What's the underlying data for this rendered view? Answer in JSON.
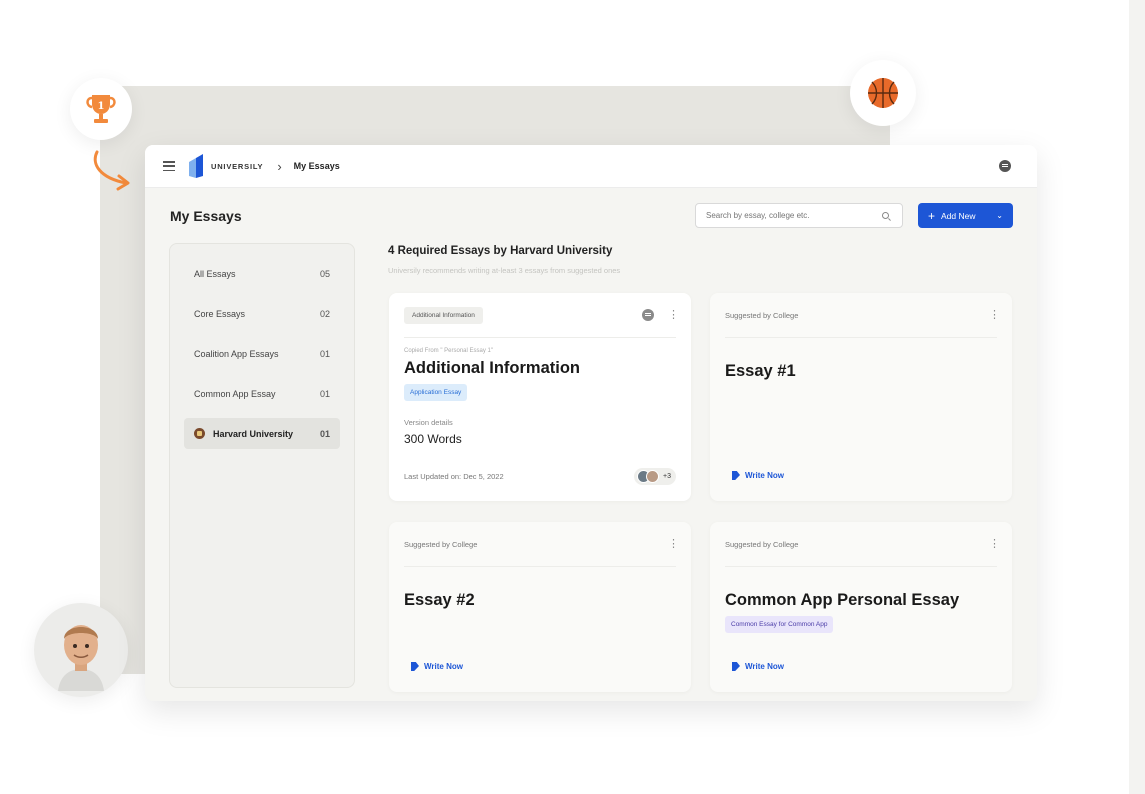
{
  "app": {
    "brand": "UNIVERSILY",
    "breadcrumb": "My Essays"
  },
  "page": {
    "title": "My Essays",
    "search_placeholder": "Search by essay, college etc.",
    "add_button": "Add New"
  },
  "sidebar": {
    "items": [
      {
        "label": "All Essays",
        "count": "05"
      },
      {
        "label": "Core Essays",
        "count": "02"
      },
      {
        "label": "Coalition App Essays",
        "count": "01"
      },
      {
        "label": "Common App Essay",
        "count": "01"
      },
      {
        "label": "Harvard University",
        "count": "01",
        "active": true
      }
    ]
  },
  "section": {
    "title": "4 Required Essays by Harvard University",
    "subtitle": "Universily recommends writing at-least 3 essays from suggested ones"
  },
  "cards": [
    {
      "tag": "Additional Information",
      "copied_from": "Copied From \" Personal Essay 1\"",
      "title": "Additional Information",
      "type_tag": "Application Essay",
      "version_label": "Version details",
      "words": "300 Words",
      "updated": "Last Updated on: Dec 5, 2022",
      "extra_collaborators": "+3"
    },
    {
      "header": "Suggested by College",
      "title": "Essay #1",
      "action": "Write Now"
    },
    {
      "header": "Suggested by College",
      "title": "Essay #2",
      "action": "Write Now"
    },
    {
      "header": "Suggested by College",
      "title": "Common App Personal Essay",
      "type_tag": "Common Essay for Common App",
      "action": "Write Now"
    }
  ],
  "decorations": {
    "trophy_number": "1"
  },
  "colors": {
    "primary": "#1d56d6",
    "accent_orange": "#f28a3c",
    "background_panel": "#e6e5e0"
  }
}
